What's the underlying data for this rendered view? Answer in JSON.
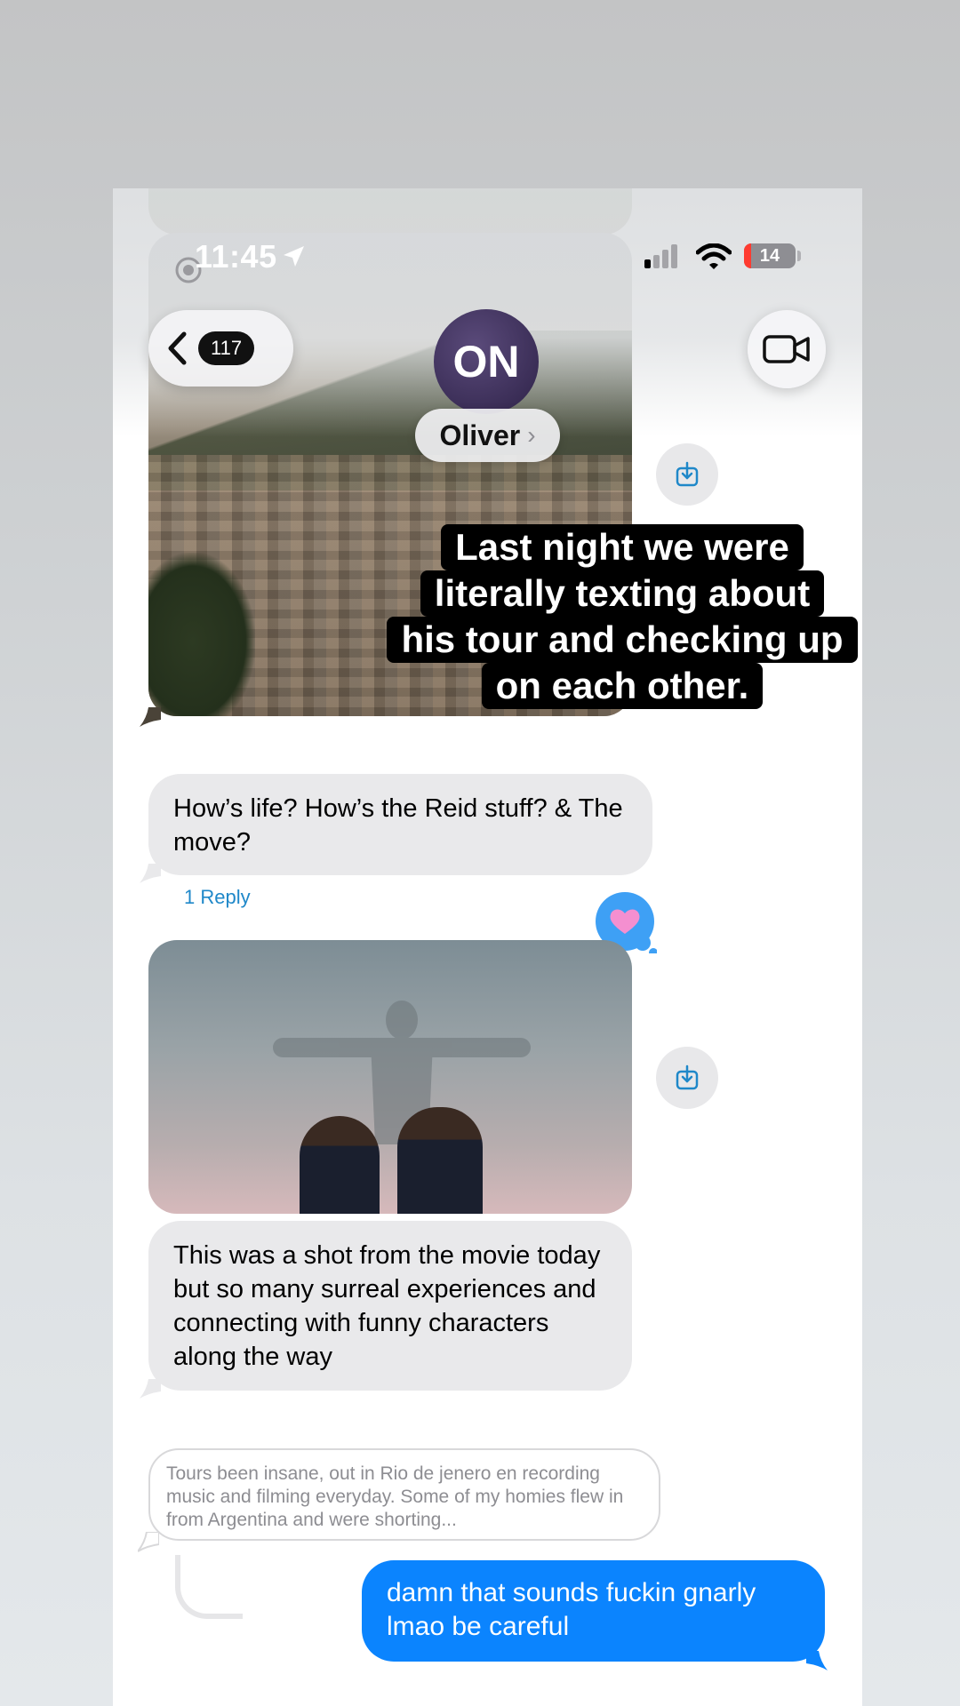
{
  "status_bar": {
    "time": "11:45",
    "battery_level": "14",
    "battery_color": "#ff3b30"
  },
  "nav": {
    "back_count": "117",
    "avatar_initials": "ON",
    "contact_name": "Oliver",
    "video_icon": "video-camera-icon"
  },
  "caption": {
    "lines": [
      "Last night we were",
      "literally texting about",
      "his tour and checking up",
      "on each other."
    ]
  },
  "messages": {
    "question": "How’s life? How’s the Reid stuff? & The move?",
    "reply_link": "1 Reply",
    "tapback": "heart",
    "shot_caption": "This was a shot from the movie today but so many surreal experiences and connecting with funny characters along the way",
    "quoted_reply": "Tours been insane, out in Rio de jenero en recording music and filming everyday. Some of my homies flew in from Argentina and were shorting...",
    "outgoing": "damn that sounds fuckin gnarly lmao be careful"
  },
  "colors": {
    "imessage_blue": "#0b84fe",
    "bubble_gray": "#e9e9eb",
    "link_blue": "#1f88c9",
    "tapback_blue": "#3ea0f5",
    "heart_pink": "#f48fd0"
  }
}
